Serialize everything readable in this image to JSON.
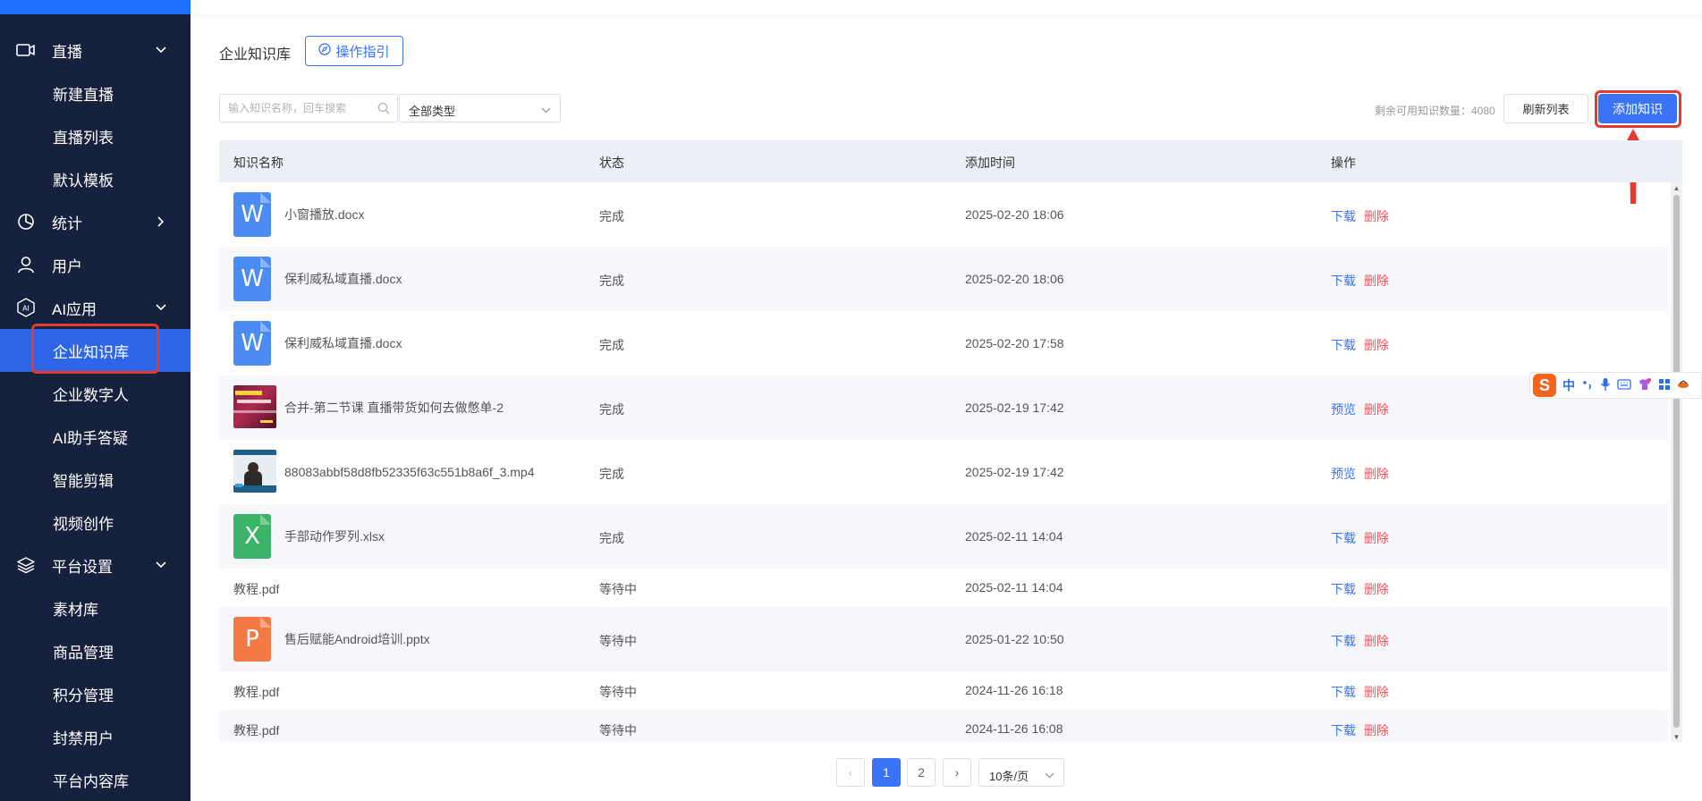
{
  "sidebar": {
    "items": [
      {
        "label": "直播",
        "icon": "video-camera-icon",
        "arrow": "chevron-down-icon",
        "type": "group"
      },
      {
        "label": "新建直播",
        "type": "sub"
      },
      {
        "label": "直播列表",
        "type": "sub"
      },
      {
        "label": "默认模板",
        "type": "sub"
      },
      {
        "label": "统计",
        "icon": "pie-chart-icon",
        "arrow": "chevron-right-icon",
        "type": "group"
      },
      {
        "label": "用户",
        "icon": "user-icon",
        "type": "group"
      },
      {
        "label": "AI应用",
        "icon": "ai-hexagon-icon",
        "arrow": "chevron-down-icon",
        "type": "group"
      },
      {
        "label": "企业知识库",
        "type": "sub",
        "active": true
      },
      {
        "label": "企业数字人",
        "type": "sub"
      },
      {
        "label": "AI助手答疑",
        "type": "sub"
      },
      {
        "label": "智能剪辑",
        "type": "sub"
      },
      {
        "label": "视频创作",
        "type": "sub"
      },
      {
        "label": "平台设置",
        "icon": "layers-icon",
        "arrow": "chevron-down-icon",
        "type": "group"
      },
      {
        "label": "素材库",
        "type": "sub"
      },
      {
        "label": "商品管理",
        "type": "sub"
      },
      {
        "label": "积分管理",
        "type": "sub"
      },
      {
        "label": "封禁用户",
        "type": "sub"
      },
      {
        "label": "平台内容库",
        "type": "sub"
      }
    ]
  },
  "header": {
    "title": "企业知识库",
    "guide_label": "操作指引"
  },
  "toolbar": {
    "search_placeholder": "输入知识名称，回车搜索",
    "type_select": "全部类型",
    "remaining": "剩余可用知识数量：4080",
    "refresh_label": "刷新列表",
    "add_label": "添加知识"
  },
  "table": {
    "columns": [
      "知识名称",
      "状态",
      "添加时间",
      "操作"
    ],
    "rows": [
      {
        "name": "小窗播放.docx",
        "status": "完成",
        "time": "2025-02-20 18:06",
        "op1": "下载",
        "op2": "删除",
        "icon": "word-file-icon"
      },
      {
        "name": "保利威私域直播.docx",
        "status": "完成",
        "time": "2025-02-20 18:06",
        "op1": "下载",
        "op2": "删除",
        "icon": "word-file-icon"
      },
      {
        "name": "保利威私域直播.docx",
        "status": "完成",
        "time": "2025-02-20 17:58",
        "op1": "下载",
        "op2": "删除",
        "icon": "word-file-icon"
      },
      {
        "name": "合并-第二节课 直播带货如何去做憋单-2",
        "status": "完成",
        "time": "2025-02-19 17:42",
        "op1": "预览",
        "op2": "删除",
        "icon": "video-thumbnail-icon"
      },
      {
        "name": "88083abbf58d8fb52335f63c551b8a6f_3.mp4",
        "status": "完成",
        "time": "2025-02-19 17:42",
        "op1": "预览",
        "op2": "删除",
        "icon": "video-thumbnail-icon"
      },
      {
        "name": "手部动作罗列.xlsx",
        "status": "完成",
        "time": "2025-02-11 14:04",
        "op1": "下载",
        "op2": "删除",
        "icon": "excel-file-icon"
      },
      {
        "name": "教程.pdf",
        "status": "等待中",
        "time": "2025-02-11 14:04",
        "op1": "下载",
        "op2": "删除",
        "icon": ""
      },
      {
        "name": "售后赋能Android培训.pptx",
        "status": "等待中",
        "time": "2025-01-22 10:50",
        "op1": "下载",
        "op2": "删除",
        "icon": "powerpoint-file-icon"
      },
      {
        "name": "教程.pdf",
        "status": "等待中",
        "time": "2024-11-26 16:18",
        "op1": "下载",
        "op2": "删除",
        "icon": ""
      },
      {
        "name": "教程.pdf",
        "status": "等待中",
        "time": "2024-11-26 16:08",
        "op1": "下载",
        "op2": "删除",
        "icon": ""
      }
    ]
  },
  "pagination": {
    "prev": "‹",
    "pages": [
      "1",
      "2"
    ],
    "current": "1",
    "next": "›",
    "page_size": "10条/页"
  },
  "ime": {
    "logo": "S",
    "lang": "中"
  },
  "colors": {
    "sidebar_bg": "#16213d",
    "accent": "#3a73f5",
    "danger": "#f0545b",
    "highlight_outline": "#e53b2e"
  }
}
